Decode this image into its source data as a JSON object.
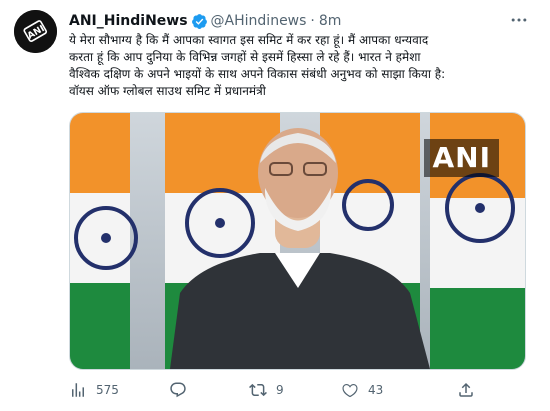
{
  "tweet": {
    "author_name": "ANI_HindiNews",
    "handle": "@AHindinews",
    "separator": "·",
    "time": "8m",
    "avatar_logo_text": "ANI",
    "text_lines": [
      "ये मेरा सौभाग्य है कि मैं आपका स्वागत इस समिट में कर रहा हूं। मैं आपका धन्यवाद",
      "करता हूं कि आप दुनिया के विभिन्न जगहों से इसमें हिस्सा ले रहे हैं। भारत ने हमेशा",
      "वैश्विक दक्षिण के अपने भाइयों के साथ अपने विकास संबंधी अनुभव को साझा किया है:",
      "वॉयस ऑफ ग्लोबल साउथ समिट में प्रधानमंत्री"
    ],
    "media": {
      "watermark": "ANI",
      "colors": {
        "saffron": "#f2922a",
        "green": "#1e8a3e",
        "chakra": "#23306b",
        "white": "#f4f4f4"
      }
    },
    "actions": {
      "views_count": "575",
      "reply_count": "",
      "retweet_count": "9",
      "like_count": "43",
      "icons": [
        "views-icon",
        "reply-icon",
        "retweet-icon",
        "like-icon",
        "share-icon"
      ]
    },
    "colors": {
      "accent": "#1d9bf0",
      "muted": "#536471",
      "text": "#0f1419"
    }
  }
}
